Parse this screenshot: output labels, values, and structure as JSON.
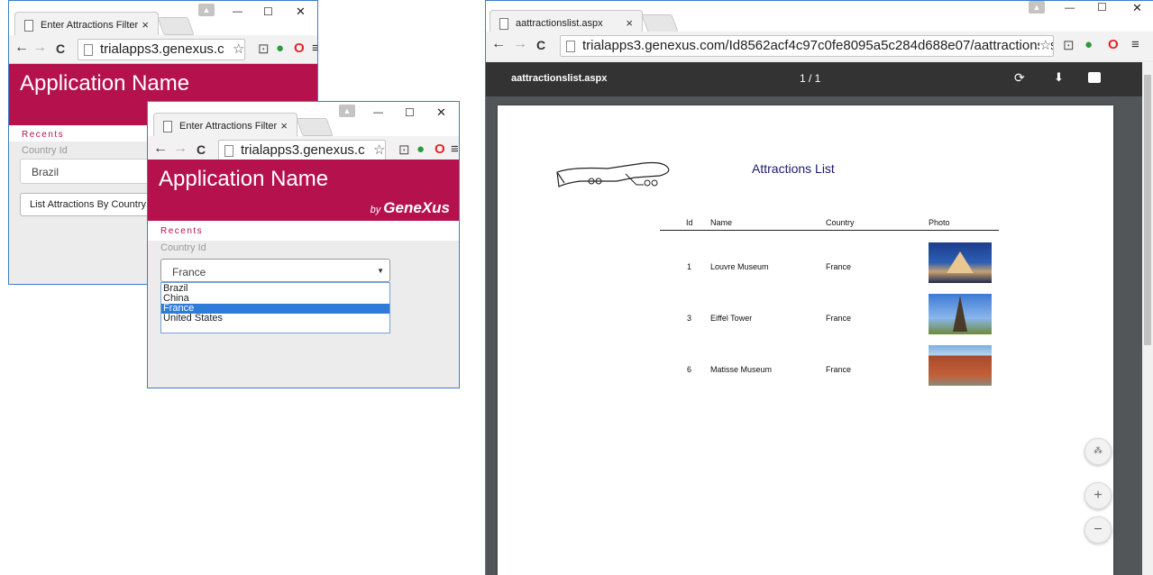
{
  "window1": {
    "tab_title": "Enter Attractions Filter",
    "tab_close": "×",
    "url": "trialapps3.genexus.c",
    "app_title": "Application Name",
    "recents": "Recents",
    "country_label": "Country Id",
    "country_value": "Brazil",
    "button": "List Attractions By Country"
  },
  "window2": {
    "tab_title": "Enter Attractions Filter",
    "tab_close": "×",
    "url": "trialapps3.genexus.c",
    "app_title": "Application Name",
    "by": "by",
    "brand": "GeneXus",
    "recents": "Recents",
    "country_label": "Country Id",
    "country_value": "France",
    "options": [
      "Brazil",
      "China",
      "France",
      "United States"
    ],
    "selected_index": 2
  },
  "window3": {
    "tab_title": "aattractionslist.aspx",
    "tab_close": "×",
    "url": "trialapps3.genexus.com/Id8562acf4c97c0fe8095a5c284d688e07/aattractionslist.aspx",
    "pdf_title": "aattractionslist.aspx",
    "page_indicator": "1 / 1",
    "report": {
      "title": "Attractions List",
      "columns": [
        "Id",
        "Name",
        "Country",
        "Photo"
      ],
      "rows": [
        {
          "id": "1",
          "name": "Louvre Museum",
          "country": "France"
        },
        {
          "id": "3",
          "name": "Eiffel Tower",
          "country": "France"
        },
        {
          "id": "6",
          "name": "Matisse Museum",
          "country": "France"
        }
      ]
    }
  },
  "icons": {
    "back": "←",
    "forward": "→",
    "reload": "C",
    "minimize": "—",
    "maximize": "☐",
    "close": "✕",
    "star": "☆",
    "menu": "≡",
    "rotate": "⟳",
    "download": "⬇",
    "print": "🖶",
    "fit": "⋄",
    "zoom_in": "+",
    "zoom_out": "−"
  },
  "colors": {
    "brand": "#b5124d",
    "window_border": "#3c7ec9",
    "dropdown_selected": "#2e7bd9",
    "pdf_toolbar": "#333333"
  }
}
